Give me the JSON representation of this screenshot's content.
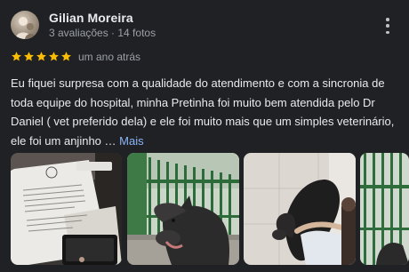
{
  "review": {
    "author_name": "Gilian Moreira",
    "author_meta": "3 avaliações · 14 fotos",
    "rating": 5,
    "rating_max": 5,
    "date": "um ano atrás",
    "text": "Eu fiquei surpresa com a qualidade do atendimento e com a sincronia de toda equipe do hospital, minha Pretinha foi muito bem atendida pelo Dr Daniel ( vet preferido dela) e ele foi muito mais que um simples veterinário, ele foi um anjinho …",
    "more_label": "Mais",
    "photos": [
      {
        "icon": "letter-photo"
      },
      {
        "icon": "dog-at-gate-photo"
      },
      {
        "icon": "dog-with-person-photo"
      },
      {
        "icon": "green-gate-photo"
      }
    ]
  },
  "colors": {
    "background": "#202124",
    "text_primary": "#e8eaed",
    "text_secondary": "#9aa0a6",
    "star": "#fbbc04",
    "link": "#8ab4f8"
  }
}
